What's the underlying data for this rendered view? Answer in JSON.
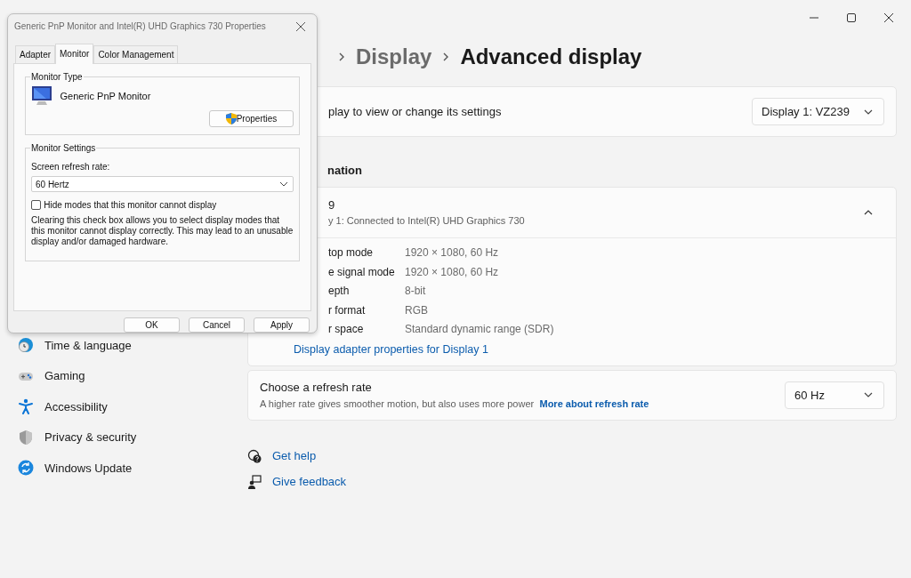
{
  "breadcrumb": [
    {
      "label": "Display",
      "current": false
    },
    {
      "label": "Advanced display",
      "current": true
    }
  ],
  "sidebar": {
    "items": [
      {
        "label": "Time & language"
      },
      {
        "label": "Gaming"
      },
      {
        "label": "Accessibility"
      },
      {
        "label": "Privacy & security"
      },
      {
        "label": "Windows Update"
      }
    ]
  },
  "display_select": {
    "label": "play to view or change its settings",
    "value": "Display 1: VZ239"
  },
  "section_heading": "nation",
  "display_info": {
    "title": "9",
    "subtitle": "y 1: Connected to Intel(R) UHD Graphics 730",
    "expanded": true,
    "rows": [
      {
        "label": "top mode",
        "value": "1920 × 1080, 60 Hz"
      },
      {
        "label": "e signal mode",
        "value": "1920 × 1080, 60 Hz"
      },
      {
        "label": "epth",
        "value": "8-bit"
      },
      {
        "label": "r format",
        "value": "RGB"
      },
      {
        "label": "r space",
        "value": "Standard dynamic range (SDR)"
      }
    ],
    "link": "Display adapter properties for Display 1"
  },
  "refresh": {
    "title": "Choose a refresh rate",
    "description": "A higher rate gives smoother motion, but also uses more power",
    "link": "More about refresh rate",
    "value": "60 Hz"
  },
  "help_links": [
    "Get help",
    "Give feedback"
  ],
  "dialog": {
    "title": "Generic PnP Monitor and Intel(R) UHD Graphics 730 Properties",
    "tabs": [
      {
        "label": "Adapter",
        "selected": false
      },
      {
        "label": "Monitor",
        "selected": true
      },
      {
        "label": "Color Management",
        "selected": false
      }
    ],
    "monitor_type": {
      "legend": "Monitor Type",
      "name": "Generic PnP Monitor",
      "button": "Properties"
    },
    "monitor_settings": {
      "legend": "Monitor Settings",
      "refresh_label": "Screen refresh rate:",
      "refresh_value": "60 Hertz",
      "hide_modes": {
        "label": "Hide modes that this monitor cannot display",
        "checked": false
      },
      "warning": "Clearing this check box allows you to select display modes that this monitor cannot display correctly. This may lead to an unusable display and/or damaged hardware."
    },
    "buttons": [
      "OK",
      "Cancel",
      "Apply"
    ]
  }
}
